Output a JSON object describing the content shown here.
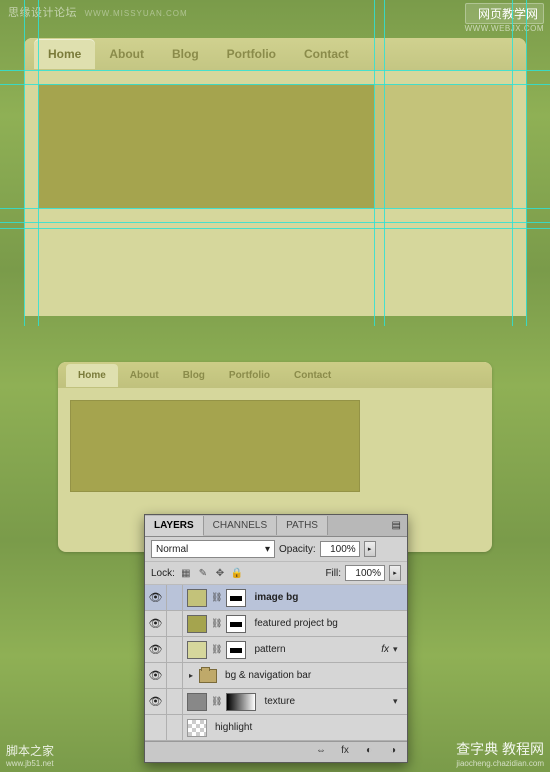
{
  "watermarks": {
    "top_left": "思缘设计论坛",
    "top_left_sub": "WWW.MISSYUAN.COM",
    "top_right_box": "网页教学网",
    "top_right_url": "WWW.WEBJX.COM",
    "bottom_left": "脚本之家",
    "bottom_left_url": "www.jb51.net",
    "bottom_right": "查字典 教程网",
    "bottom_right_url": "jiaocheng.chazidian.com"
  },
  "nav": {
    "items": [
      "Home",
      "About",
      "Blog",
      "Portfolio",
      "Contact"
    ],
    "active_index": 0
  },
  "layers_panel": {
    "tabs": [
      "LAYERS",
      "CHANNELS",
      "PATHS"
    ],
    "active_tab": 0,
    "blend_mode": "Normal",
    "opacity_label": "Opacity:",
    "opacity_value": "100%",
    "lock_label": "Lock:",
    "fill_label": "Fill:",
    "fill_value": "100%",
    "layers": [
      {
        "name": "image bg",
        "visible": true,
        "selected": true,
        "swatch": "#c3c27a",
        "has_mask": true,
        "fx": false,
        "type": "layer"
      },
      {
        "name": "featured project bg",
        "visible": true,
        "selected": false,
        "swatch": "#a5a44e",
        "has_mask": true,
        "fx": false,
        "type": "layer"
      },
      {
        "name": "pattern",
        "visible": true,
        "selected": false,
        "swatch": "#d6d79c",
        "has_mask": true,
        "fx": true,
        "type": "layer"
      },
      {
        "name": "bg & navigation bar",
        "visible": true,
        "selected": false,
        "type": "group"
      },
      {
        "name": "texture",
        "visible": true,
        "selected": false,
        "type": "gradient",
        "has_mask": true
      },
      {
        "name": "highlight",
        "visible": false,
        "selected": false,
        "type": "empty"
      }
    ]
  }
}
